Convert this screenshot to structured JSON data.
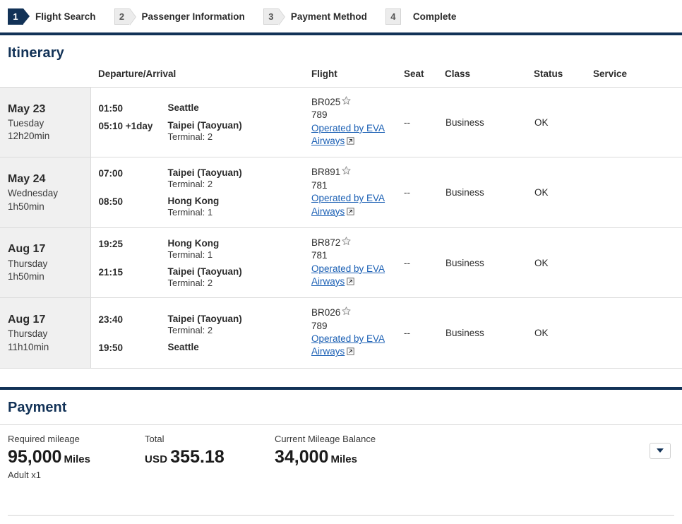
{
  "steps": [
    {
      "number": "1",
      "label": "Flight Search",
      "state": "active",
      "arrow": true
    },
    {
      "number": "2",
      "label": "Passenger Information",
      "state": "inactive",
      "arrow": true
    },
    {
      "number": "3",
      "label": "Payment Method",
      "state": "inactive",
      "arrow": true
    },
    {
      "number": "4",
      "label": "Complete",
      "state": "inactive",
      "arrow": false
    }
  ],
  "itinerary": {
    "title": "Itinerary",
    "columns": {
      "date": "",
      "departure_arrival": "Departure/Arrival",
      "flight": "Flight",
      "seat": "Seat",
      "class": "Class",
      "status": "Status",
      "service": "Service"
    },
    "rows": [
      {
        "date": "May 23",
        "weekday": "Tuesday",
        "duration": "12h20min",
        "depart_time": "01:50",
        "depart_city": "Seattle",
        "depart_terminal": "",
        "arrive_time": "05:10",
        "arrive_dayoffset": "+1day",
        "arrive_city": "Taipei (Taoyuan)",
        "arrive_terminal": "Terminal: 2",
        "flight_no": "BR025",
        "aircraft": "789",
        "operated_by": "Operated by EVA Airways",
        "seat": "--",
        "class": "Business",
        "status": "OK",
        "service": ""
      },
      {
        "date": "May 24",
        "weekday": "Wednesday",
        "duration": "1h50min",
        "depart_time": "07:00",
        "depart_city": "Taipei (Taoyuan)",
        "depart_terminal": "Terminal: 2",
        "arrive_time": "08:50",
        "arrive_dayoffset": "",
        "arrive_city": "Hong Kong",
        "arrive_terminal": "Terminal: 1",
        "flight_no": "BR891",
        "aircraft": "781",
        "operated_by": "Operated by EVA Airways",
        "seat": "--",
        "class": "Business",
        "status": "OK",
        "service": ""
      },
      {
        "date": "Aug 17",
        "weekday": "Thursday",
        "duration": "1h50min",
        "depart_time": "19:25",
        "depart_city": "Hong Kong",
        "depart_terminal": "Terminal: 1",
        "arrive_time": "21:15",
        "arrive_dayoffset": "",
        "arrive_city": "Taipei (Taoyuan)",
        "arrive_terminal": "Terminal: 2",
        "flight_no": "BR872",
        "aircraft": "781",
        "operated_by": "Operated by EVA Airways",
        "seat": "--",
        "class": "Business",
        "status": "OK",
        "service": ""
      },
      {
        "date": "Aug 17",
        "weekday": "Thursday",
        "duration": "11h10min",
        "depart_time": "23:40",
        "depart_city": "Taipei (Taoyuan)",
        "depart_terminal": "Terminal: 2",
        "arrive_time": "19:50",
        "arrive_dayoffset": "",
        "arrive_city": "Seattle",
        "arrive_terminal": "",
        "flight_no": "BR026",
        "aircraft": "789",
        "operated_by": "Operated by EVA Airways",
        "seat": "--",
        "class": "Business",
        "status": "OK",
        "service": ""
      }
    ]
  },
  "payment": {
    "title": "Payment",
    "required_mileage_label": "Required mileage",
    "required_mileage_value": "95,000",
    "required_mileage_unit": "Miles",
    "passengers": "Adult x1",
    "total_label": "Total",
    "total_currency": "USD",
    "total_value": "355.18",
    "balance_label": "Current Mileage Balance",
    "balance_value": "34,000",
    "balance_unit": "Miles"
  },
  "colors": {
    "navy": "#123257",
    "link": "#1a5fb4",
    "row_date_bg": "#f0f0f0",
    "border": "#dcdcdc"
  },
  "icons": {
    "star": "star-icon",
    "external_link": "external-link-icon",
    "caret": "chevron-down-icon"
  }
}
